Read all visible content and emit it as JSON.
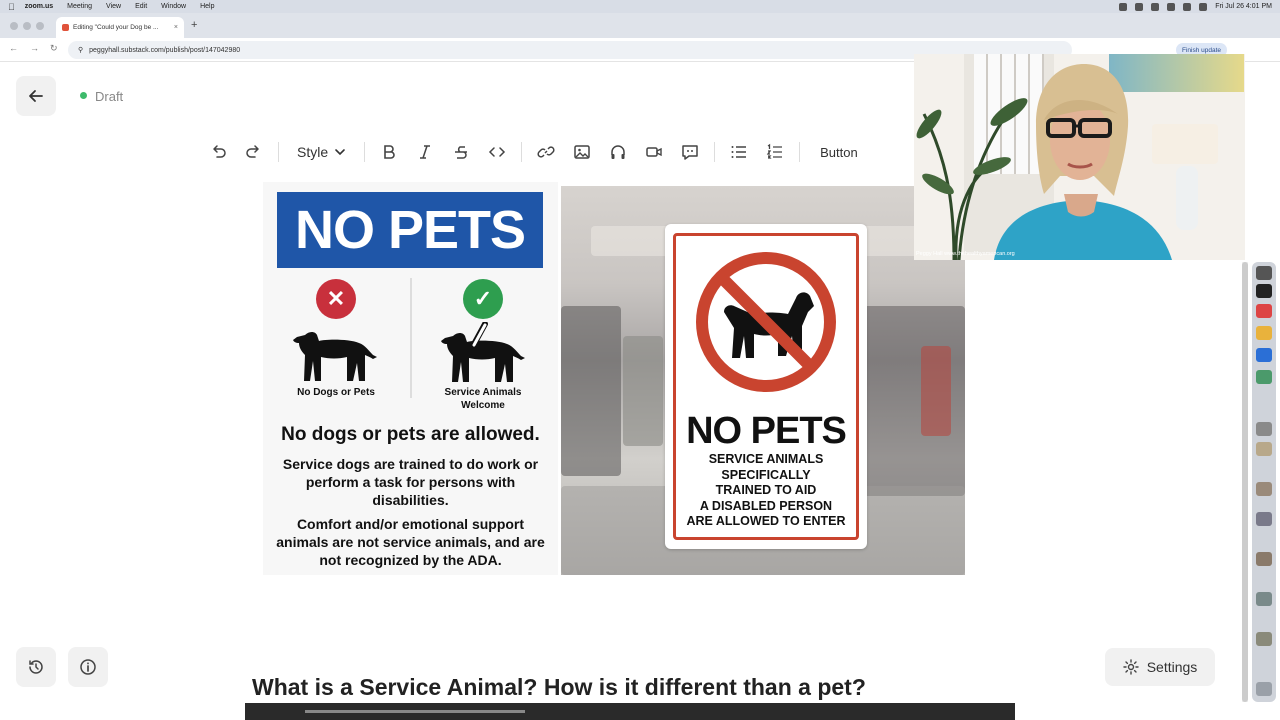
{
  "menubar": {
    "app": "zoom.us",
    "items": [
      "Meeting",
      "View",
      "Edit",
      "Window",
      "Help"
    ],
    "clock": "Fri Jul 26  4:01 PM"
  },
  "browser": {
    "tab_title": "Editing \"Could your Dog be ...",
    "url": "peggyhall.substack.com/publish/post/147042980",
    "finish_update": "Finish update"
  },
  "editor": {
    "status": "Draft",
    "toolbar": {
      "style_label": "Style",
      "button_label": "Button"
    },
    "settings_label": "Settings",
    "heading": "What is a Service Animal? How is it different than a pet?"
  },
  "sign_left": {
    "title": "NO PETS",
    "dog_left_caption": "No Dogs or Pets",
    "dog_right_caption": "Service Animals Welcome",
    "main_line": "No dogs or pets are allowed.",
    "para1": "Service dogs are trained to do work or perform a task for persons with disabilities.",
    "para2": "Comfort and/or emotional support animals are not service animals, and are not recognized by the ADA."
  },
  "sign_right": {
    "title": "NO PETS",
    "subtitle_lines": [
      "SERVICE ANIMALS",
      "SPECIFICALLY",
      "TRAINED TO AID",
      "A DISABLED PERSON",
      "ARE ALLOWED TO ENTER"
    ]
  },
  "webcam": {
    "caption": "Peggy Hall www.thehealthyamerican.org"
  },
  "colors": {
    "accent_blue": "#1f56a8",
    "prohibit_red": "#c9442f",
    "check_green": "#2e9e4f",
    "x_red": "#c8303c",
    "draft_green": "#3dba6b"
  }
}
